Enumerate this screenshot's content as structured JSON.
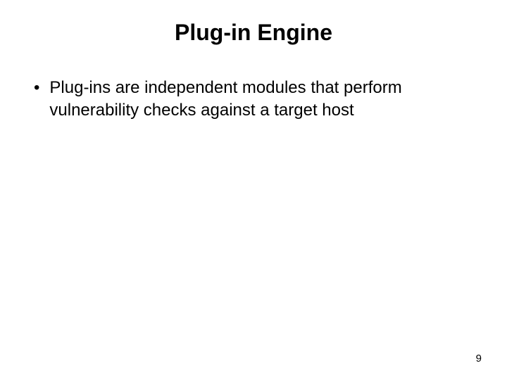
{
  "slide": {
    "title": "Plug-in Engine",
    "bullets": [
      {
        "marker": "•",
        "text": "Plug-ins are independent modules that perform vulnerability checks against a target host"
      }
    ],
    "page_number": "9"
  }
}
